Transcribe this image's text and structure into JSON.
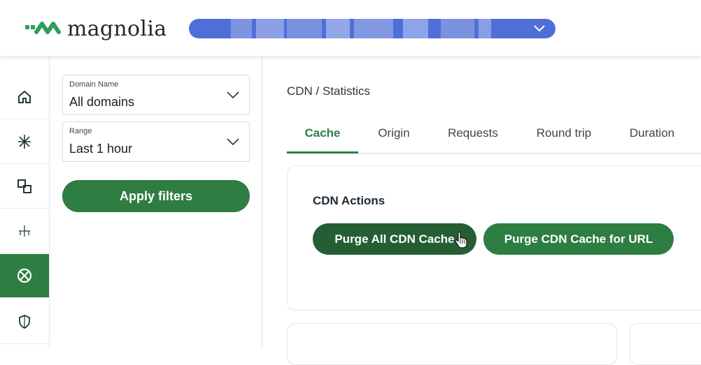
{
  "header": {
    "brand": "magnolia",
    "brand_color": "#2e9e5b",
    "environment_selector": {
      "value": "",
      "color": "#4f6fd8",
      "icon": "chevron-down-icon"
    }
  },
  "rail": {
    "items": [
      {
        "id": "home",
        "icon": "home-icon",
        "active": false
      },
      {
        "id": "asterisk",
        "icon": "asterisk-icon",
        "active": false
      },
      {
        "id": "squares",
        "icon": "overlapping-squares-icon",
        "active": false
      },
      {
        "id": "tree",
        "icon": "sitemap-icon",
        "active": false
      },
      {
        "id": "cdn",
        "icon": "cdn-globe-icon",
        "active": true
      },
      {
        "id": "security",
        "icon": "shield-icon",
        "active": false
      }
    ],
    "active_color": "#2e7d42"
  },
  "filters": {
    "domain": {
      "label": "Domain Name",
      "value": "All domains"
    },
    "range": {
      "label": "Range",
      "value": "Last 1 hour"
    },
    "apply_label": "Apply filters"
  },
  "main": {
    "breadcrumb": "CDN / Statistics",
    "tabs": [
      {
        "label": "Cache",
        "active": true
      },
      {
        "label": "Origin",
        "active": false
      },
      {
        "label": "Requests",
        "active": false
      },
      {
        "label": "Round trip",
        "active": false
      },
      {
        "label": "Duration",
        "active": false
      }
    ],
    "cdn_actions": {
      "title": "CDN Actions",
      "purge_all_label": "Purge All CDN Cache",
      "purge_url_label": "Purge CDN Cache for URL"
    }
  }
}
